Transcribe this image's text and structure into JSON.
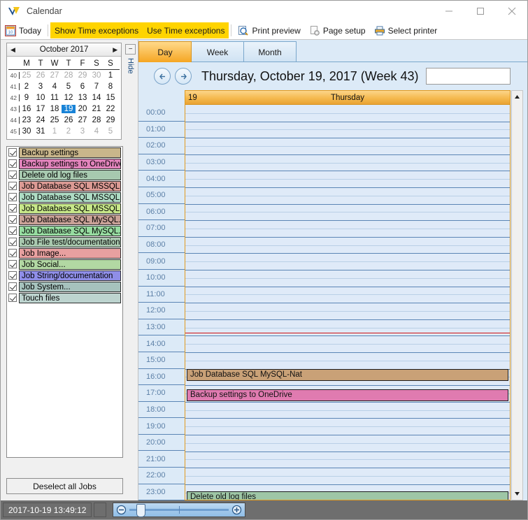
{
  "window": {
    "title": "Calendar",
    "icon": "app-logo-icon",
    "minimize": "—",
    "maximize": "□",
    "close": "✕"
  },
  "toolbar": {
    "today_label": "Today",
    "today_icon": "calendar-today-icon",
    "show_time_exceptions": "Show Time exceptions",
    "use_time_exceptions": "Use Time exceptions",
    "print_preview": "Print preview",
    "print_preview_icon": "print-preview-icon",
    "page_setup": "Page setup",
    "page_setup_icon": "page-setup-icon",
    "select_printer": "Select printer",
    "select_printer_icon": "printer-icon",
    "highlight_color": "#ffd400"
  },
  "sidebar": {
    "minicalendar": {
      "title": "October 2017",
      "prev_icon": "left-triangle-icon",
      "next_icon": "right-triangle-icon",
      "daynames": [
        "M",
        "T",
        "W",
        "T",
        "F",
        "S",
        "S"
      ],
      "selected_day": 19,
      "selected_color": "#1883d7",
      "weeks": [
        {
          "num": "40",
          "days": [
            {
              "d": "25",
              "out": true
            },
            {
              "d": "26",
              "out": true
            },
            {
              "d": "27",
              "out": true
            },
            {
              "d": "28",
              "out": true
            },
            {
              "d": "29",
              "out": true
            },
            {
              "d": "30",
              "out": true
            },
            {
              "d": "1",
              "out": false
            }
          ]
        },
        {
          "num": "41",
          "days": [
            {
              "d": "2"
            },
            {
              "d": "3"
            },
            {
              "d": "4"
            },
            {
              "d": "5"
            },
            {
              "d": "6"
            },
            {
              "d": "7"
            },
            {
              "d": "8"
            }
          ]
        },
        {
          "num": "42",
          "days": [
            {
              "d": "9"
            },
            {
              "d": "10"
            },
            {
              "d": "11"
            },
            {
              "d": "12"
            },
            {
              "d": "13"
            },
            {
              "d": "14"
            },
            {
              "d": "15"
            }
          ]
        },
        {
          "num": "43",
          "days": [
            {
              "d": "16"
            },
            {
              "d": "17"
            },
            {
              "d": "18"
            },
            {
              "d": "19",
              "sel": true
            },
            {
              "d": "20"
            },
            {
              "d": "21"
            },
            {
              "d": "22"
            }
          ]
        },
        {
          "num": "44",
          "days": [
            {
              "d": "23"
            },
            {
              "d": "24"
            },
            {
              "d": "25"
            },
            {
              "d": "26"
            },
            {
              "d": "27"
            },
            {
              "d": "28"
            },
            {
              "d": "29"
            }
          ]
        },
        {
          "num": "45",
          "days": [
            {
              "d": "30"
            },
            {
              "d": "31"
            },
            {
              "d": "1",
              "out": true
            },
            {
              "d": "2",
              "out": true
            },
            {
              "d": "3",
              "out": true
            },
            {
              "d": "4",
              "out": true
            },
            {
              "d": "5",
              "out": true
            }
          ]
        }
      ]
    },
    "hide_panel": {
      "collapse_icon": "−",
      "label": "Hide"
    },
    "jobs": [
      {
        "label": "Backup settings",
        "color": "#c9b68b",
        "checked": true
      },
      {
        "label": "Backup settings to OneDrive",
        "color": "#e183bb",
        "checked": true
      },
      {
        "label": "Delete old log files",
        "color": "#a7c9af",
        "checked": true
      },
      {
        "label": "Job Database SQL MSSQL...",
        "color": "#dc9a94",
        "checked": true
      },
      {
        "label": "Job Database SQL MSSQL...",
        "color": "#aedcc4",
        "checked": true
      },
      {
        "label": "Job Database SQL MSSQL...",
        "color": "#c8e88a",
        "checked": true
      },
      {
        "label": "Job Database SQL MySQL...",
        "color": "#c9a197",
        "checked": true
      },
      {
        "label": "Job Database SQL MySQL...",
        "color": "#96dca0",
        "checked": true
      },
      {
        "label": "Job File test/documentation",
        "color": "#a8c8ae",
        "checked": true
      },
      {
        "label": "Job Image...",
        "color": "#e8a0a0",
        "checked": true
      },
      {
        "label": "Job Social...",
        "color": "#b2d8a3",
        "checked": true
      },
      {
        "label": "Job String/documentation",
        "color": "#8f8ee8",
        "checked": true
      },
      {
        "label": "Job System...",
        "color": "#a6c2bd",
        "checked": true
      },
      {
        "label": "Touch files",
        "color": "#bdd4cf",
        "checked": true
      }
    ],
    "deselect_button": "Deselect all Jobs"
  },
  "main": {
    "tabs": [
      {
        "label": "Day",
        "active": true
      },
      {
        "label": "Week",
        "active": false
      },
      {
        "label": "Month",
        "active": false
      }
    ],
    "nav": {
      "prev_icon": "arrow-left-icon",
      "next_icon": "arrow-right-icon",
      "title": "Thursday, October 19, 2017 (Week 43)",
      "search_value": "",
      "search_placeholder": ""
    },
    "day_header": {
      "day_number": "19",
      "day_name": "Thursday"
    },
    "hours": [
      "00:00",
      "01:00",
      "02:00",
      "03:00",
      "04:00",
      "05:00",
      "06:00",
      "07:00",
      "08:00",
      "09:00",
      "10:00",
      "11:00",
      "12:00",
      "13:00",
      "14:00",
      "15:00",
      "16:00",
      "17:00",
      "18:00",
      "19:00",
      "20:00",
      "21:00",
      "22:00",
      "23:00"
    ],
    "current_time_hour": 13.82,
    "current_time_color": "#d01010",
    "appointments": [
      {
        "label": "Job Database SQL MySQL-Nat",
        "hour": 16.0,
        "color": "#c9a177"
      },
      {
        "label": "Backup settings to OneDrive",
        "hour": 17.25,
        "color": "#e07bb0"
      },
      {
        "label": "Delete old log files",
        "hour": 23.45,
        "color": "#9ec6a6"
      }
    ],
    "scrollbar": {
      "up_icon": "scroll-up-icon",
      "down_icon": "scroll-down-icon"
    }
  },
  "statusbar": {
    "datetime": "2017-10-19 13:49:12",
    "zoom": {
      "minus_icon": "zoom-out-icon",
      "plus_icon": "zoom-in-icon"
    }
  }
}
